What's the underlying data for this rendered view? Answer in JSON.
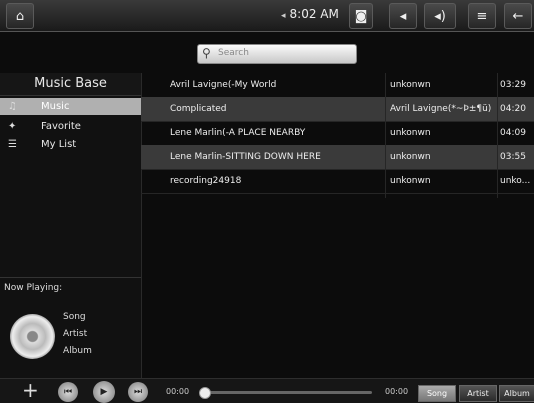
{
  "topbar": {
    "time": "8:02 AM",
    "icons": [
      "home-icon",
      "signal-icon",
      "camera-icon",
      "volume-down-icon",
      "volume-up-icon",
      "menu-icon",
      "back-icon"
    ]
  },
  "search": {
    "placeholder": "Search"
  },
  "sidebar": {
    "title": "Music Base",
    "items": [
      {
        "label": "Music",
        "icon": "music-note-icon",
        "active": true
      },
      {
        "label": "Favorite",
        "icon": "star-icon",
        "active": false
      },
      {
        "label": "My List",
        "icon": "list-icon",
        "active": false
      }
    ]
  },
  "now_playing": {
    "label": "Now Playing:",
    "song": "Song",
    "artist": "Artist",
    "album": "Album"
  },
  "tracks": [
    {
      "title": "Avril Lavigne(-My World",
      "artist": "unkonwn",
      "duration": "03:29"
    },
    {
      "title": "Complicated",
      "artist": "Avril Lavigne(*~Þ±¶ü)",
      "duration": "04:20"
    },
    {
      "title": "Lene Marlin(-A PLACE NEARBY",
      "artist": "unkonwn",
      "duration": "04:09"
    },
    {
      "title": "Lene Marlin-SITTING DOWN HERE",
      "artist": "unkonwn",
      "duration": "03:55"
    },
    {
      "title": "recording24918",
      "artist": "unkonwn",
      "duration": "unko..."
    }
  ],
  "player": {
    "add": "+",
    "time_current": "00:00",
    "time_total": "00:00",
    "progress": 0,
    "tabs": [
      {
        "label": "Song",
        "selected": true
      },
      {
        "label": "Artist",
        "selected": false
      },
      {
        "label": "Album",
        "selected": false
      }
    ]
  }
}
